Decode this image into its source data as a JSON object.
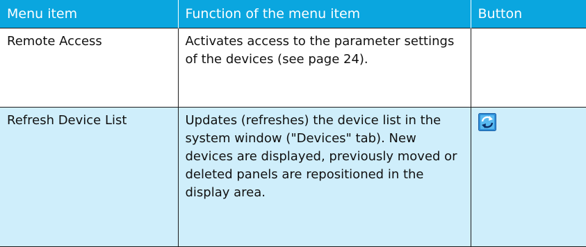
{
  "table": {
    "headers": {
      "menu_item": "Menu item",
      "function": "Function of the menu item",
      "button": "Button"
    },
    "rows": [
      {
        "menu_item": "Remote Access",
        "function": "Activates access to the parameter settings of the devices (see page 24).",
        "button_icon": ""
      },
      {
        "menu_item": "Refresh Device List",
        "function": "Updates (refreshes) the device list in the system window (\"Devices\" tab). New devices are displayed, previously moved or deleted panels are repositioned in the display area.",
        "button_icon": "refresh-icon"
      }
    ]
  },
  "colors": {
    "header_bg": "#0aa6df",
    "header_text": "#ffffff",
    "highlight_row_bg": "#cfeefb",
    "border": "#1a1a1a"
  }
}
